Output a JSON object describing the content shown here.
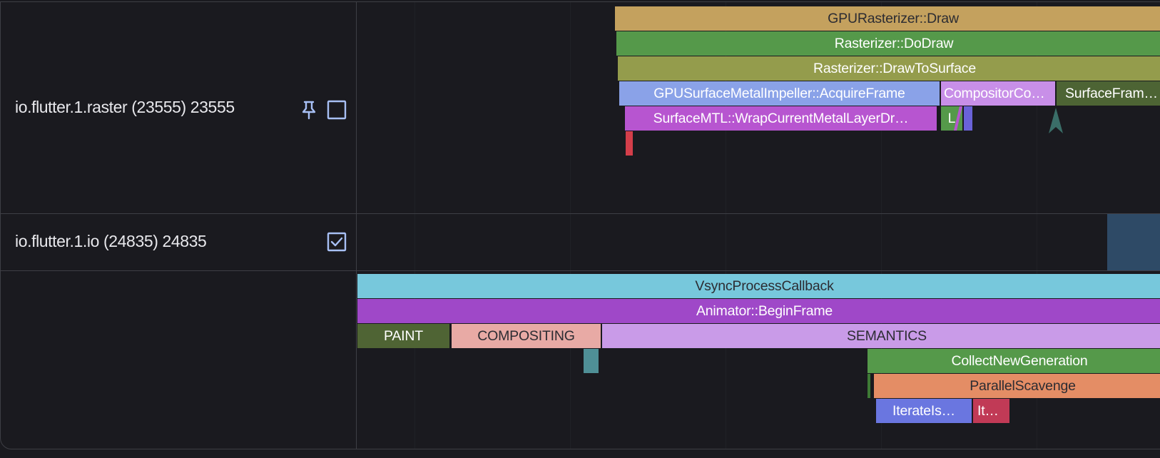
{
  "tracks": [
    {
      "label": "io.flutter.1.raster (23555) 23555",
      "pinned": true,
      "checked": false
    },
    {
      "label": "io.flutter.1.io (24835) 24835",
      "checked": true
    },
    {
      "label": ""
    }
  ],
  "raster_slices": {
    "gpu_rasterizer_draw": "GPURasterizer::Draw",
    "rasterizer_do_draw": "Rasterizer::DoDraw",
    "rasterizer_draw_to_surface": "Rasterizer::DrawToSurface",
    "acquire_frame": "GPUSurfaceMetalImpeller::AcquireFrame",
    "compositor": "CompositorCo…",
    "surface_frame": "SurfaceFram…",
    "wrap_current": "SurfaceMTL::WrapCurrentMetalLayerDr…",
    "small_l": "L"
  },
  "ui_slices": {
    "vsync": "VsyncProcessCallback",
    "begin_frame": "Animator::BeginFrame",
    "paint": "PAINT",
    "compositing": "COMPOSITING",
    "semantics": "SEMANTICS",
    "collect_new_generation": "CollectNewGeneration",
    "parallel_scavenge": "ParallelScavenge",
    "iterate1": "IterateIs…",
    "iterate2": "It…"
  },
  "colors": {
    "background": "#1a1a1f",
    "border": "#3e3f45",
    "checkbox": "#a8c0f5",
    "gpu_draw": "#c4a15e",
    "do_draw": "#55994a",
    "draw_to_surface": "#949c4c",
    "acquire_frame": "#8aa2e8",
    "compositor": "#c88fe8",
    "surface_frame": "#4d6434",
    "wrap_current": "#b755d0",
    "vsync": "#77c8dc",
    "begin_frame": "#9f48c8",
    "paint": "#4f6434",
    "compositing": "#e8aaa5",
    "semantics": "#c99be8",
    "collect": "#55994a",
    "scavenge": "#e48d65",
    "iterate1": "#6a76e0",
    "iterate2": "#c13a56",
    "io_block": "#2e4a66"
  }
}
